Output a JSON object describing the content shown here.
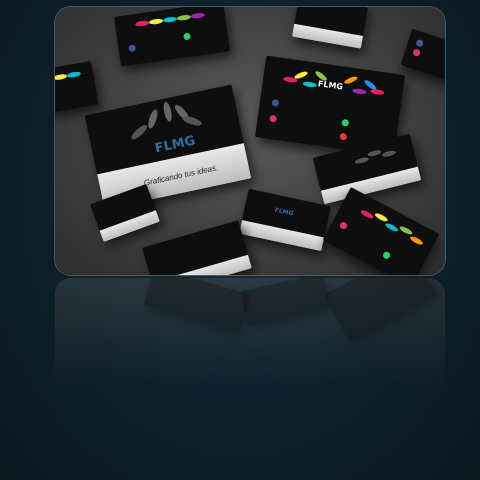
{
  "image": {
    "brand_name": "FLMG",
    "tagline": "Graficando tus ideas.",
    "colors": {
      "brand_blue": "#2e6fa8",
      "facebook": "#3b5998",
      "instagram": "#e1306c",
      "whatsapp": "#25d366",
      "map_pin": "#e53935"
    }
  }
}
